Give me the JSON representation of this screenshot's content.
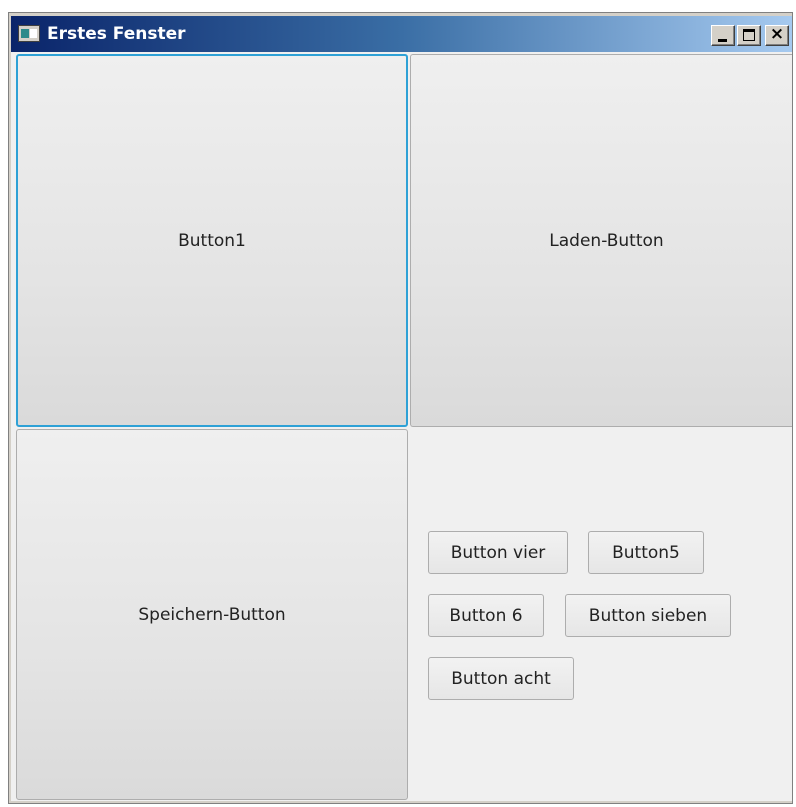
{
  "window": {
    "title": "Erstes Fenster",
    "controls": {
      "minimize_glyph": "_",
      "maximize_glyph": "□",
      "close_glyph": "×"
    }
  },
  "grid": {
    "button1_label": "Button1",
    "laden_label": "Laden-Button",
    "speichern_label": "Speichern-Button"
  },
  "flow": {
    "buttons": [
      {
        "label": "Button vier"
      },
      {
        "label": "Button5"
      },
      {
        "label": "Button 6"
      },
      {
        "label": "Button sieben"
      },
      {
        "label": "Button acht"
      }
    ]
  },
  "colors": {
    "focus_border": "#2ea1d6",
    "titlebar_start": "#0a246a",
    "titlebar_end": "#a6caf0"
  }
}
